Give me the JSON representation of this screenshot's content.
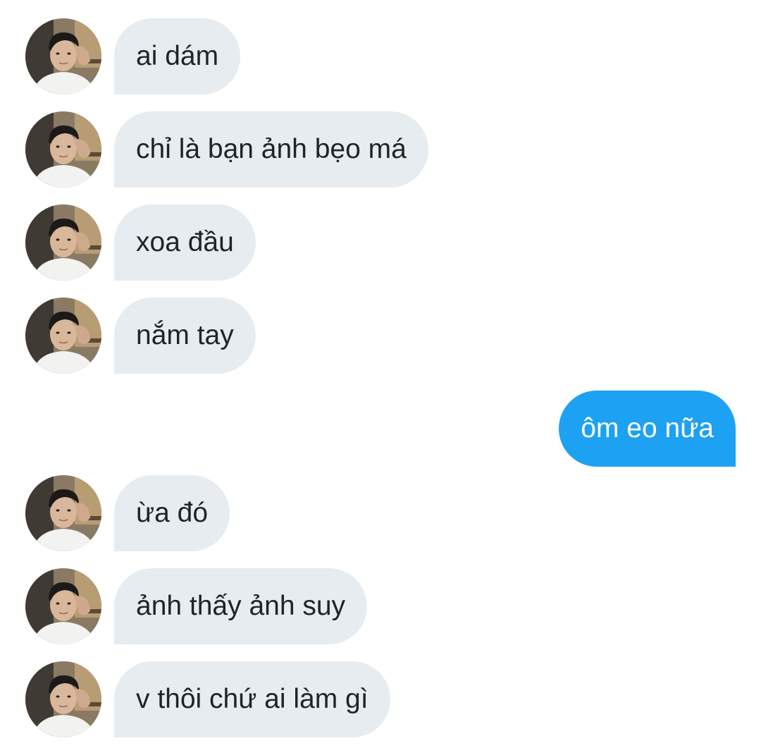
{
  "conversation": {
    "messages": [
      {
        "direction": "incoming",
        "text": "ai dám"
      },
      {
        "direction": "incoming",
        "text": "chỉ là bạn ảnh bẹo má"
      },
      {
        "direction": "incoming",
        "text": "xoa đầu"
      },
      {
        "direction": "incoming",
        "text": "nắm tay"
      },
      {
        "direction": "outgoing",
        "text": "ôm eo nữa"
      },
      {
        "direction": "incoming",
        "text": "ừa đó"
      },
      {
        "direction": "incoming",
        "text": "ảnh thấy ảnh suy"
      },
      {
        "direction": "incoming",
        "text": "v thôi chứ ai làm gì"
      }
    ]
  },
  "colors": {
    "incoming_bubble": "#e6ecf0",
    "outgoing_bubble": "#1da1f2",
    "incoming_text": "#1f2428",
    "outgoing_text": "#ffffff",
    "background": "#ffffff"
  }
}
